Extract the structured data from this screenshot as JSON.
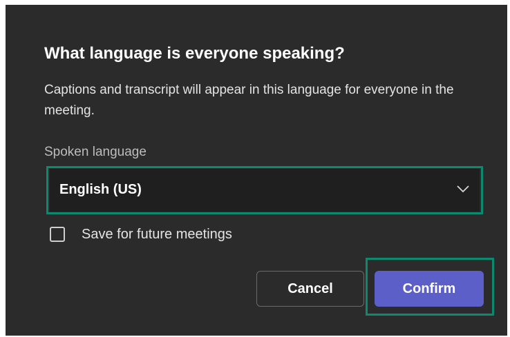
{
  "dialog": {
    "title": "What language is everyone speaking?",
    "description": "Captions and transcript will appear in this language for everyone in the meeting.",
    "language_field": {
      "label": "Spoken language",
      "selected_value": "English (US)",
      "icon": "chevron-down-icon"
    },
    "save_checkbox": {
      "label": "Save for future meetings",
      "checked": false
    },
    "buttons": {
      "cancel_label": "Cancel",
      "confirm_label": "Confirm"
    },
    "colors": {
      "background": "#2b2b2b",
      "accent": "#5b5fc7",
      "highlight": "#0a8a6e"
    }
  }
}
